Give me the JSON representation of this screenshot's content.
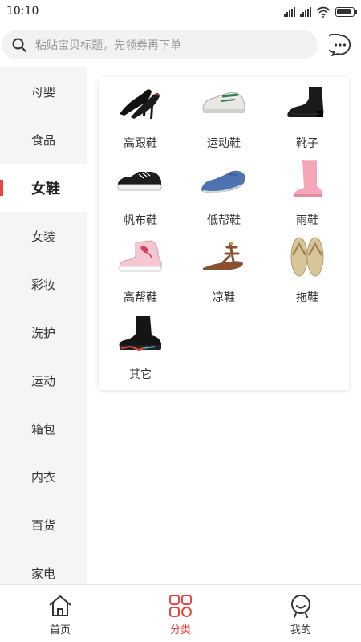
{
  "status_bar": {
    "time": "10:10"
  },
  "header": {
    "search_placeholder": "粘贴宝贝标题，先领券再下单",
    "icons": [
      "search-icon",
      "message-icon"
    ]
  },
  "sidebar": {
    "active_index": 2,
    "items": [
      {
        "label": "母婴"
      },
      {
        "label": "食品"
      },
      {
        "label": "女鞋"
      },
      {
        "label": "女装"
      },
      {
        "label": "彩妆"
      },
      {
        "label": "洗护"
      },
      {
        "label": "运动"
      },
      {
        "label": "箱包"
      },
      {
        "label": "内衣"
      },
      {
        "label": "百货"
      },
      {
        "label": "家电"
      }
    ]
  },
  "subcategories": [
    {
      "label": "高跟鞋",
      "icon": "high-heels-icon"
    },
    {
      "label": "运动鞋",
      "icon": "sneakers-icon"
    },
    {
      "label": "靴子",
      "icon": "boots-icon"
    },
    {
      "label": "帆布鞋",
      "icon": "canvas-shoes-icon"
    },
    {
      "label": "低帮鞋",
      "icon": "loafers-icon"
    },
    {
      "label": "雨鞋",
      "icon": "rain-boots-icon"
    },
    {
      "label": "高帮鞋",
      "icon": "high-top-icon"
    },
    {
      "label": "凉鞋",
      "icon": "sandals-icon"
    },
    {
      "label": "拖鞋",
      "icon": "flip-flops-icon"
    },
    {
      "label": "其它",
      "icon": "other-shoes-icon"
    }
  ],
  "tab_bar": {
    "active_index": 1,
    "tabs": [
      {
        "label": "首页",
        "icon": "home-icon"
      },
      {
        "label": "分类",
        "icon": "category-icon"
      },
      {
        "label": "我的",
        "icon": "profile-icon"
      }
    ]
  },
  "colors": {
    "accent": "#e8473d",
    "sidebar_bg": "#f5f5f5",
    "text": "#333333"
  }
}
